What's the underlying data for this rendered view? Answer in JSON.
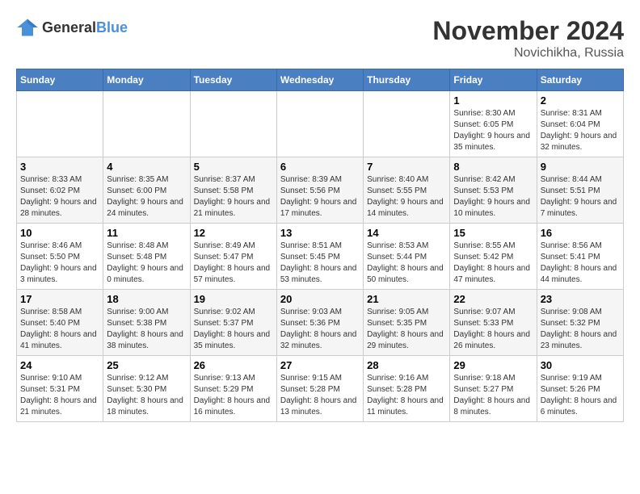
{
  "logo": {
    "general": "General",
    "blue": "Blue"
  },
  "title": "November 2024",
  "location": "Novichikha, Russia",
  "days_of_week": [
    "Sunday",
    "Monday",
    "Tuesday",
    "Wednesday",
    "Thursday",
    "Friday",
    "Saturday"
  ],
  "weeks": [
    [
      {
        "day": "",
        "info": ""
      },
      {
        "day": "",
        "info": ""
      },
      {
        "day": "",
        "info": ""
      },
      {
        "day": "",
        "info": ""
      },
      {
        "day": "",
        "info": ""
      },
      {
        "day": "1",
        "info": "Sunrise: 8:30 AM\nSunset: 6:05 PM\nDaylight: 9 hours and 35 minutes."
      },
      {
        "day": "2",
        "info": "Sunrise: 8:31 AM\nSunset: 6:04 PM\nDaylight: 9 hours and 32 minutes."
      }
    ],
    [
      {
        "day": "3",
        "info": "Sunrise: 8:33 AM\nSunset: 6:02 PM\nDaylight: 9 hours and 28 minutes."
      },
      {
        "day": "4",
        "info": "Sunrise: 8:35 AM\nSunset: 6:00 PM\nDaylight: 9 hours and 24 minutes."
      },
      {
        "day": "5",
        "info": "Sunrise: 8:37 AM\nSunset: 5:58 PM\nDaylight: 9 hours and 21 minutes."
      },
      {
        "day": "6",
        "info": "Sunrise: 8:39 AM\nSunset: 5:56 PM\nDaylight: 9 hours and 17 minutes."
      },
      {
        "day": "7",
        "info": "Sunrise: 8:40 AM\nSunset: 5:55 PM\nDaylight: 9 hours and 14 minutes."
      },
      {
        "day": "8",
        "info": "Sunrise: 8:42 AM\nSunset: 5:53 PM\nDaylight: 9 hours and 10 minutes."
      },
      {
        "day": "9",
        "info": "Sunrise: 8:44 AM\nSunset: 5:51 PM\nDaylight: 9 hours and 7 minutes."
      }
    ],
    [
      {
        "day": "10",
        "info": "Sunrise: 8:46 AM\nSunset: 5:50 PM\nDaylight: 9 hours and 3 minutes."
      },
      {
        "day": "11",
        "info": "Sunrise: 8:48 AM\nSunset: 5:48 PM\nDaylight: 9 hours and 0 minutes."
      },
      {
        "day": "12",
        "info": "Sunrise: 8:49 AM\nSunset: 5:47 PM\nDaylight: 8 hours and 57 minutes."
      },
      {
        "day": "13",
        "info": "Sunrise: 8:51 AM\nSunset: 5:45 PM\nDaylight: 8 hours and 53 minutes."
      },
      {
        "day": "14",
        "info": "Sunrise: 8:53 AM\nSunset: 5:44 PM\nDaylight: 8 hours and 50 minutes."
      },
      {
        "day": "15",
        "info": "Sunrise: 8:55 AM\nSunset: 5:42 PM\nDaylight: 8 hours and 47 minutes."
      },
      {
        "day": "16",
        "info": "Sunrise: 8:56 AM\nSunset: 5:41 PM\nDaylight: 8 hours and 44 minutes."
      }
    ],
    [
      {
        "day": "17",
        "info": "Sunrise: 8:58 AM\nSunset: 5:40 PM\nDaylight: 8 hours and 41 minutes."
      },
      {
        "day": "18",
        "info": "Sunrise: 9:00 AM\nSunset: 5:38 PM\nDaylight: 8 hours and 38 minutes."
      },
      {
        "day": "19",
        "info": "Sunrise: 9:02 AM\nSunset: 5:37 PM\nDaylight: 8 hours and 35 minutes."
      },
      {
        "day": "20",
        "info": "Sunrise: 9:03 AM\nSunset: 5:36 PM\nDaylight: 8 hours and 32 minutes."
      },
      {
        "day": "21",
        "info": "Sunrise: 9:05 AM\nSunset: 5:35 PM\nDaylight: 8 hours and 29 minutes."
      },
      {
        "day": "22",
        "info": "Sunrise: 9:07 AM\nSunset: 5:33 PM\nDaylight: 8 hours and 26 minutes."
      },
      {
        "day": "23",
        "info": "Sunrise: 9:08 AM\nSunset: 5:32 PM\nDaylight: 8 hours and 23 minutes."
      }
    ],
    [
      {
        "day": "24",
        "info": "Sunrise: 9:10 AM\nSunset: 5:31 PM\nDaylight: 8 hours and 21 minutes."
      },
      {
        "day": "25",
        "info": "Sunrise: 9:12 AM\nSunset: 5:30 PM\nDaylight: 8 hours and 18 minutes."
      },
      {
        "day": "26",
        "info": "Sunrise: 9:13 AM\nSunset: 5:29 PM\nDaylight: 8 hours and 16 minutes."
      },
      {
        "day": "27",
        "info": "Sunrise: 9:15 AM\nSunset: 5:28 PM\nDaylight: 8 hours and 13 minutes."
      },
      {
        "day": "28",
        "info": "Sunrise: 9:16 AM\nSunset: 5:28 PM\nDaylight: 8 hours and 11 minutes."
      },
      {
        "day": "29",
        "info": "Sunrise: 9:18 AM\nSunset: 5:27 PM\nDaylight: 8 hours and 8 minutes."
      },
      {
        "day": "30",
        "info": "Sunrise: 9:19 AM\nSunset: 5:26 PM\nDaylight: 8 hours and 6 minutes."
      }
    ]
  ]
}
